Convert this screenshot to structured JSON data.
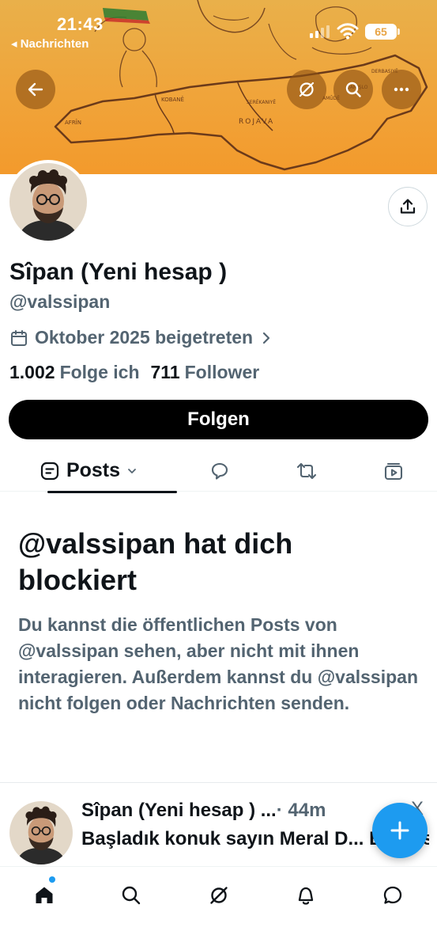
{
  "status_bar": {
    "time": "21:43",
    "back_app": "◂ Nachrichten",
    "battery": "65"
  },
  "banner": {
    "map_labels": [
      "AFRÎN",
      "KOBANÊ",
      "SERÊKANIYÊ",
      "ROJAVA",
      "DERBASIYÊ",
      "QAMIŞLO",
      "AMÛDÊ"
    ]
  },
  "profile": {
    "name": "Sîpan (Yeni hesap )",
    "handle": "@valssipan",
    "joined": "Oktober 2025 beigetreten",
    "following_count": "1.002",
    "following_label": "Folge ich",
    "followers_count": "711",
    "followers_label": "Follower",
    "follow_button": "Folgen"
  },
  "tabs": {
    "posts_label": "Posts"
  },
  "blocked": {
    "title": "@valssipan hat dich blockiert",
    "description": "Du kannst die öffentlichen Posts von @valssipan sehen, aber nicht mit ihnen interagieren. Außerdem kannst du @valssipan nicht folgen oder Nachrichten senden."
  },
  "post": {
    "author": "Sîpan (Yeni hesap ) ...",
    "time": "· 44m",
    "more": "X",
    "text": "Başladık konuk sayın Meral D... Bostos"
  },
  "colors": {
    "accent": "#1d9bf0",
    "banner": "#f0a43a",
    "secondary_text": "#536471"
  },
  "icons": [
    "back-arrow-icon",
    "grok-icon",
    "search-icon",
    "more-icon",
    "share-icon",
    "calendar-icon",
    "chevron-right-icon",
    "posts-icon",
    "reply-icon",
    "retweet-icon",
    "media-icon",
    "plus-icon",
    "home-icon",
    "notifications-icon",
    "messages-icon"
  ]
}
